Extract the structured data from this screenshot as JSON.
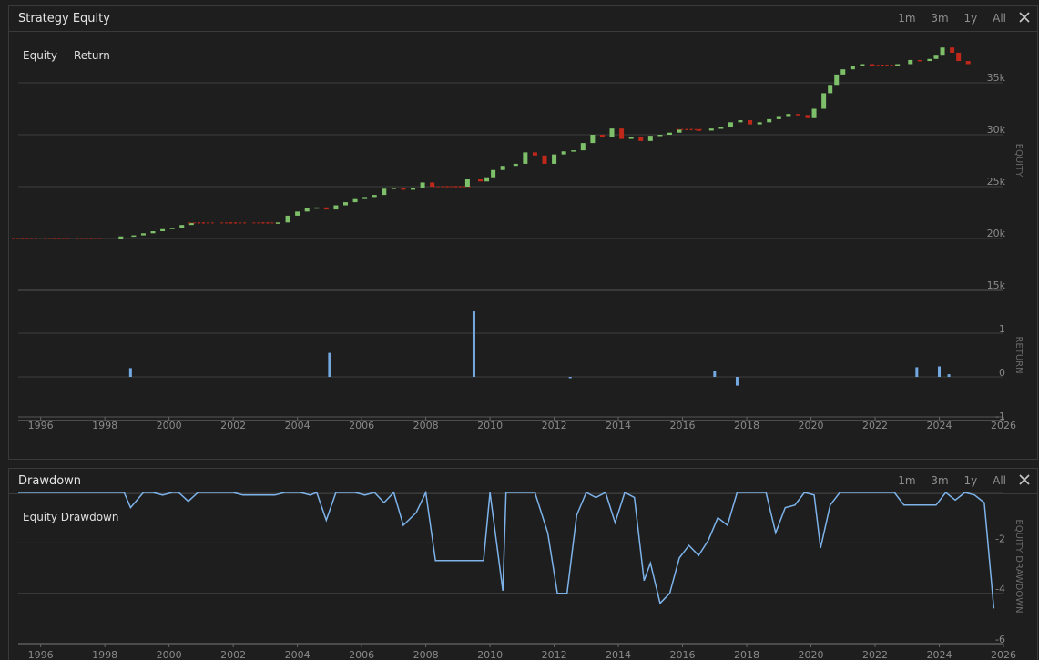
{
  "equity_panel": {
    "title": "Strategy Equity",
    "range_buttons": [
      "1m",
      "3m",
      "1y",
      "All"
    ],
    "legend": [
      "Equity",
      "Return"
    ],
    "equity_axis_label": "EQUITY",
    "return_axis_label": "RETURN",
    "equity_ticks": [
      "35k",
      "30k",
      "25k",
      "20k",
      "15k"
    ],
    "return_ticks": [
      "1",
      "0",
      "-1"
    ],
    "x_ticks": [
      "1996",
      "1998",
      "2000",
      "2002",
      "2004",
      "2006",
      "2008",
      "2010",
      "2012",
      "2014",
      "2016",
      "2018",
      "2020",
      "2022",
      "2024",
      "2026"
    ]
  },
  "drawdown_panel": {
    "title": "Drawdown",
    "range_buttons": [
      "1m",
      "3m",
      "1y",
      "All"
    ],
    "legend": [
      "Equity Drawdown"
    ],
    "axis_label": "EQUITY DRAWDOWN",
    "y_ticks": [
      "-2",
      "-4",
      "-6"
    ],
    "x_ticks": [
      "1996",
      "1998",
      "2000",
      "2002",
      "2004",
      "2006",
      "2008",
      "2010",
      "2012",
      "2014",
      "2016",
      "2018",
      "2020",
      "2022",
      "2024",
      "2026"
    ]
  },
  "colors": {
    "up": "#7ec06a",
    "down": "#c0281a",
    "flat": "#c0281a",
    "return_bar": "#74a8e0",
    "drawdown_line": "#7db3ea",
    "grid": "#3d3d3d",
    "axis_text": "#8a8a8a"
  },
  "chart_data": [
    {
      "type": "candlestick",
      "name": "Equity",
      "xlim": [
        1995.3,
        2026
      ],
      "ylim": [
        15000,
        39000
      ],
      "points": [
        [
          1995.5,
          20000,
          20000
        ],
        [
          1996.5,
          20000,
          20000
        ],
        [
          1997.5,
          20000,
          20000
        ],
        [
          1998.5,
          20000,
          20200
        ],
        [
          1998.9,
          20200,
          20300
        ],
        [
          1999.2,
          20300,
          20500
        ],
        [
          1999.5,
          20500,
          20700
        ],
        [
          1999.8,
          20700,
          20900
        ],
        [
          2000.1,
          20900,
          21050
        ],
        [
          2000.4,
          21050,
          21300
        ],
        [
          2000.7,
          21300,
          21500
        ],
        [
          2001,
          21500,
          21500
        ],
        [
          2002,
          21500,
          21500
        ],
        [
          2003,
          21500,
          21500
        ],
        [
          2003.4,
          21500,
          21550
        ],
        [
          2003.7,
          21550,
          22200
        ],
        [
          2004,
          22200,
          22600
        ],
        [
          2004.3,
          22600,
          22900
        ],
        [
          2004.6,
          22900,
          23000
        ],
        [
          2004.9,
          23000,
          22800
        ],
        [
          2005.2,
          22800,
          23200
        ],
        [
          2005.5,
          23200,
          23500
        ],
        [
          2005.8,
          23500,
          23800
        ],
        [
          2006.1,
          23800,
          24000
        ],
        [
          2006.4,
          24000,
          24200
        ],
        [
          2006.7,
          24200,
          24800
        ],
        [
          2007,
          24800,
          24900
        ],
        [
          2007.3,
          24900,
          24700
        ],
        [
          2007.6,
          24700,
          24900
        ],
        [
          2007.9,
          24900,
          25400
        ],
        [
          2008.2,
          25400,
          25000
        ],
        [
          2008.6,
          25000,
          25000
        ],
        [
          2009,
          25000,
          25000
        ],
        [
          2009.3,
          25000,
          25700
        ],
        [
          2009.7,
          25700,
          25500
        ],
        [
          2009.9,
          25500,
          25900
        ],
        [
          2010.1,
          25900,
          26600
        ],
        [
          2010.4,
          26600,
          27000
        ],
        [
          2010.8,
          27000,
          27200
        ],
        [
          2011.1,
          27200,
          28300
        ],
        [
          2011.4,
          28300,
          28000
        ],
        [
          2011.7,
          28000,
          27200
        ],
        [
          2012,
          27200,
          28100
        ],
        [
          2012.3,
          28100,
          28400
        ],
        [
          2012.6,
          28400,
          28500
        ],
        [
          2012.9,
          28500,
          29200
        ],
        [
          2013.2,
          29200,
          30000
        ],
        [
          2013.5,
          30000,
          29800
        ],
        [
          2013.8,
          29800,
          30600
        ],
        [
          2014.1,
          30600,
          29600
        ],
        [
          2014.4,
          29600,
          29800
        ],
        [
          2014.7,
          29800,
          29400
        ],
        [
          2015,
          29400,
          29900
        ],
        [
          2015.3,
          29900,
          30000
        ],
        [
          2015.6,
          30000,
          30200
        ],
        [
          2015.9,
          30200,
          30500
        ],
        [
          2016.2,
          30500,
          30500
        ],
        [
          2016.5,
          30500,
          30400
        ],
        [
          2016.9,
          30400,
          30600
        ],
        [
          2017.2,
          30600,
          30700
        ],
        [
          2017.5,
          30700,
          31200
        ],
        [
          2017.8,
          31200,
          31400
        ],
        [
          2018.1,
          31400,
          31000
        ],
        [
          2018.4,
          31000,
          31200
        ],
        [
          2018.7,
          31200,
          31500
        ],
        [
          2019,
          31500,
          31800
        ],
        [
          2019.3,
          31800,
          32000
        ],
        [
          2019.6,
          32000,
          31900
        ],
        [
          2019.9,
          31900,
          31600
        ],
        [
          2020.1,
          31600,
          32500
        ],
        [
          2020.4,
          32500,
          34000
        ],
        [
          2020.6,
          34000,
          34800
        ],
        [
          2020.8,
          34800,
          35800
        ],
        [
          2021,
          35800,
          36300
        ],
        [
          2021.3,
          36300,
          36600
        ],
        [
          2021.6,
          36600,
          36800
        ],
        [
          2021.9,
          36800,
          36700
        ],
        [
          2022.3,
          36700,
          36700
        ],
        [
          2022.7,
          36700,
          36800
        ],
        [
          2023.1,
          36800,
          37200
        ],
        [
          2023.4,
          37200,
          37100
        ],
        [
          2023.7,
          37100,
          37300
        ],
        [
          2023.9,
          37300,
          37700
        ],
        [
          2024.1,
          37700,
          38400
        ],
        [
          2024.4,
          38400,
          37900
        ],
        [
          2024.6,
          37900,
          37100
        ],
        [
          2024.9,
          37100,
          36800
        ]
      ]
    },
    {
      "type": "bar",
      "name": "Return",
      "xlim": [
        1995.3,
        2026
      ],
      "ylim": [
        -1,
        1
      ],
      "points": [
        [
          1998.8,
          0.2
        ],
        [
          2005.0,
          0.55
        ],
        [
          2009.5,
          1.5
        ],
        [
          2012.5,
          -0.03
        ],
        [
          2017.0,
          0.13
        ],
        [
          2017.7,
          -0.2
        ],
        [
          2023.3,
          0.22
        ],
        [
          2024.0,
          0.24
        ],
        [
          2024.3,
          0.06
        ]
      ]
    },
    {
      "type": "line",
      "name": "Equity Drawdown",
      "xlim": [
        1995.3,
        2026
      ],
      "ylim": [
        -6,
        0
      ],
      "points": [
        [
          1995.3,
          0
        ],
        [
          1998.6,
          0
        ],
        [
          1998.8,
          -0.6
        ],
        [
          1999.2,
          0
        ],
        [
          1999.5,
          0
        ],
        [
          1999.8,
          -0.1
        ],
        [
          2000.1,
          0
        ],
        [
          2000.3,
          0
        ],
        [
          2000.6,
          -0.35
        ],
        [
          2000.9,
          0
        ],
        [
          2002.0,
          0
        ],
        [
          2002.3,
          -0.1
        ],
        [
          2003.3,
          -0.1
        ],
        [
          2003.6,
          0
        ],
        [
          2004.1,
          0
        ],
        [
          2004.4,
          -0.1
        ],
        [
          2004.6,
          0
        ],
        [
          2004.9,
          -1.1
        ],
        [
          2005.2,
          0
        ],
        [
          2005.8,
          0
        ],
        [
          2006.1,
          -0.1
        ],
        [
          2006.4,
          0
        ],
        [
          2006.7,
          -0.4
        ],
        [
          2007.0,
          0
        ],
        [
          2007.3,
          -1.3
        ],
        [
          2007.7,
          -0.8
        ],
        [
          2008.0,
          0
        ],
        [
          2008.3,
          -2.7
        ],
        [
          2009.8,
          -2.7
        ],
        [
          2010.0,
          0
        ],
        [
          2010.4,
          -3.9
        ],
        [
          2010.5,
          0
        ],
        [
          2011.4,
          0
        ],
        [
          2011.8,
          -1.6
        ],
        [
          2012.1,
          -4.0
        ],
        [
          2012.4,
          -4.0
        ],
        [
          2012.7,
          -0.9
        ],
        [
          2013.0,
          0
        ],
        [
          2013.3,
          -0.2
        ],
        [
          2013.6,
          0
        ],
        [
          2013.9,
          -1.2
        ],
        [
          2014.2,
          0
        ],
        [
          2014.5,
          -0.2
        ],
        [
          2014.8,
          -3.5
        ],
        [
          2015.0,
          -2.8
        ],
        [
          2015.3,
          -4.4
        ],
        [
          2015.6,
          -4.0
        ],
        [
          2015.9,
          -2.6
        ],
        [
          2016.2,
          -2.1
        ],
        [
          2016.5,
          -2.5
        ],
        [
          2016.8,
          -1.9
        ],
        [
          2017.1,
          -1.0
        ],
        [
          2017.4,
          -1.3
        ],
        [
          2017.7,
          0
        ],
        [
          2018.6,
          0
        ],
        [
          2018.9,
          -1.6
        ],
        [
          2019.2,
          -0.6
        ],
        [
          2019.5,
          -0.5
        ],
        [
          2019.8,
          0
        ],
        [
          2020.1,
          -0.1
        ],
        [
          2020.3,
          -2.2
        ],
        [
          2020.6,
          -0.5
        ],
        [
          2020.9,
          0
        ],
        [
          2022.6,
          0
        ],
        [
          2022.9,
          -0.5
        ],
        [
          2023.9,
          -0.5
        ],
        [
          2024.2,
          0
        ],
        [
          2024.5,
          -0.3
        ],
        [
          2024.8,
          0
        ],
        [
          2025.1,
          -0.1
        ],
        [
          2025.4,
          -0.4
        ],
        [
          2025.7,
          -4.6
        ]
      ]
    }
  ]
}
